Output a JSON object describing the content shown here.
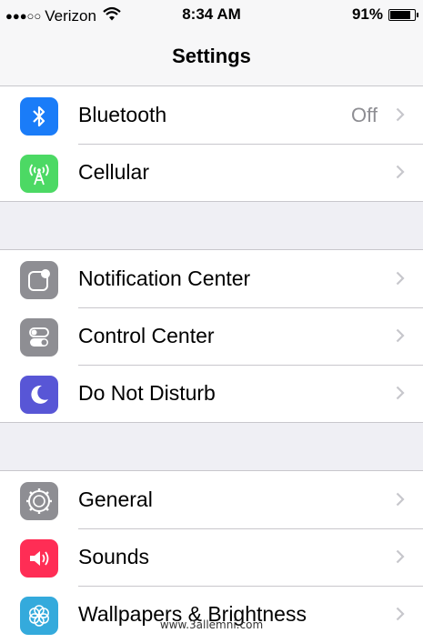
{
  "status_bar": {
    "signal": "●●●○○",
    "carrier": "Verizon",
    "time": "8:34 AM",
    "battery_percent": "91%",
    "battery_level": 0.91
  },
  "nav": {
    "title": "Settings"
  },
  "groups": [
    {
      "rows": [
        {
          "label": "Bluetooth",
          "value": "Off",
          "icon": "bluetooth-icon",
          "icon_color": "#1a7cf8"
        },
        {
          "label": "Cellular",
          "value": "",
          "icon": "cellular-antenna-icon",
          "icon_color": "#4cd964"
        }
      ]
    },
    {
      "rows": [
        {
          "label": "Notification Center",
          "icon": "notification-center-icon",
          "icon_color": "#8e8e93"
        },
        {
          "label": "Control Center",
          "icon": "control-center-toggles-icon",
          "icon_color": "#8e8e93"
        },
        {
          "label": "Do Not Disturb",
          "icon": "moon-icon",
          "icon_color": "#5856d6"
        }
      ]
    },
    {
      "rows": [
        {
          "label": "General",
          "icon": "gear-icon",
          "icon_color": "#8e8e93"
        },
        {
          "label": "Sounds",
          "icon": "speaker-icon",
          "icon_color": "#ff2d55"
        },
        {
          "label": "Wallpapers & Brightness",
          "icon": "flower-icon",
          "icon_color": "#34aadc"
        }
      ]
    }
  ],
  "watermark": "www.3allemni.com"
}
